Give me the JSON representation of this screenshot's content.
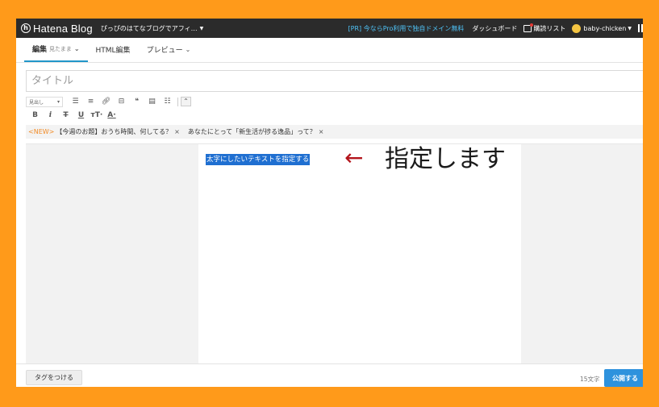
{
  "topbar": {
    "logo_text": "Hatena Blog",
    "logo_icon_glyph": "h",
    "blog_name": "ぴっぴのはてなブログでアフィ…",
    "pr_text": "[PR] 今ならPro利用で独自ドメイン無料",
    "dashboard": "ダッシュボード",
    "reader_list": "購読リスト",
    "username": "baby-chicken"
  },
  "tabs": {
    "edit_label": "編集",
    "edit_sub": "見たまま",
    "html_label": "HTML編集",
    "preview_label": "プレビュー"
  },
  "title_field": {
    "placeholder": "タイトル"
  },
  "toolbar": {
    "heading_select": "見出し",
    "icons": [
      "unordered-list-icon",
      "ordered-list-icon",
      "link-icon",
      "embed-icon",
      "quote-icon",
      "table-icon",
      "more-icon"
    ],
    "format_icons": [
      "bold-icon",
      "italic-icon",
      "strikethrough-icon",
      "underline-icon",
      "font-size-icon",
      "text-color-icon"
    ]
  },
  "theme_bar": {
    "new_badge": "<NEW>",
    "theme1": "【今週のお題】おうち時間、何してる？",
    "theme2": "あなたにとって「新生活が捗る逸品」って？",
    "close": "×"
  },
  "editor": {
    "selected_text": "太字にしたいテキストを指定する",
    "annotation_arrow": "←",
    "annotation_text": "指定します"
  },
  "footer": {
    "tag_button": "タグをつける",
    "char_count": "15文字",
    "publish_button": "公開する"
  },
  "colors": {
    "frame_border": "#ff9a1a",
    "topbar_bg": "#2b2b2b",
    "accent": "#2196c9",
    "selection": "#1f6fd1",
    "annotation_arrow": "#b3141b",
    "publish": "#2e92dd"
  }
}
